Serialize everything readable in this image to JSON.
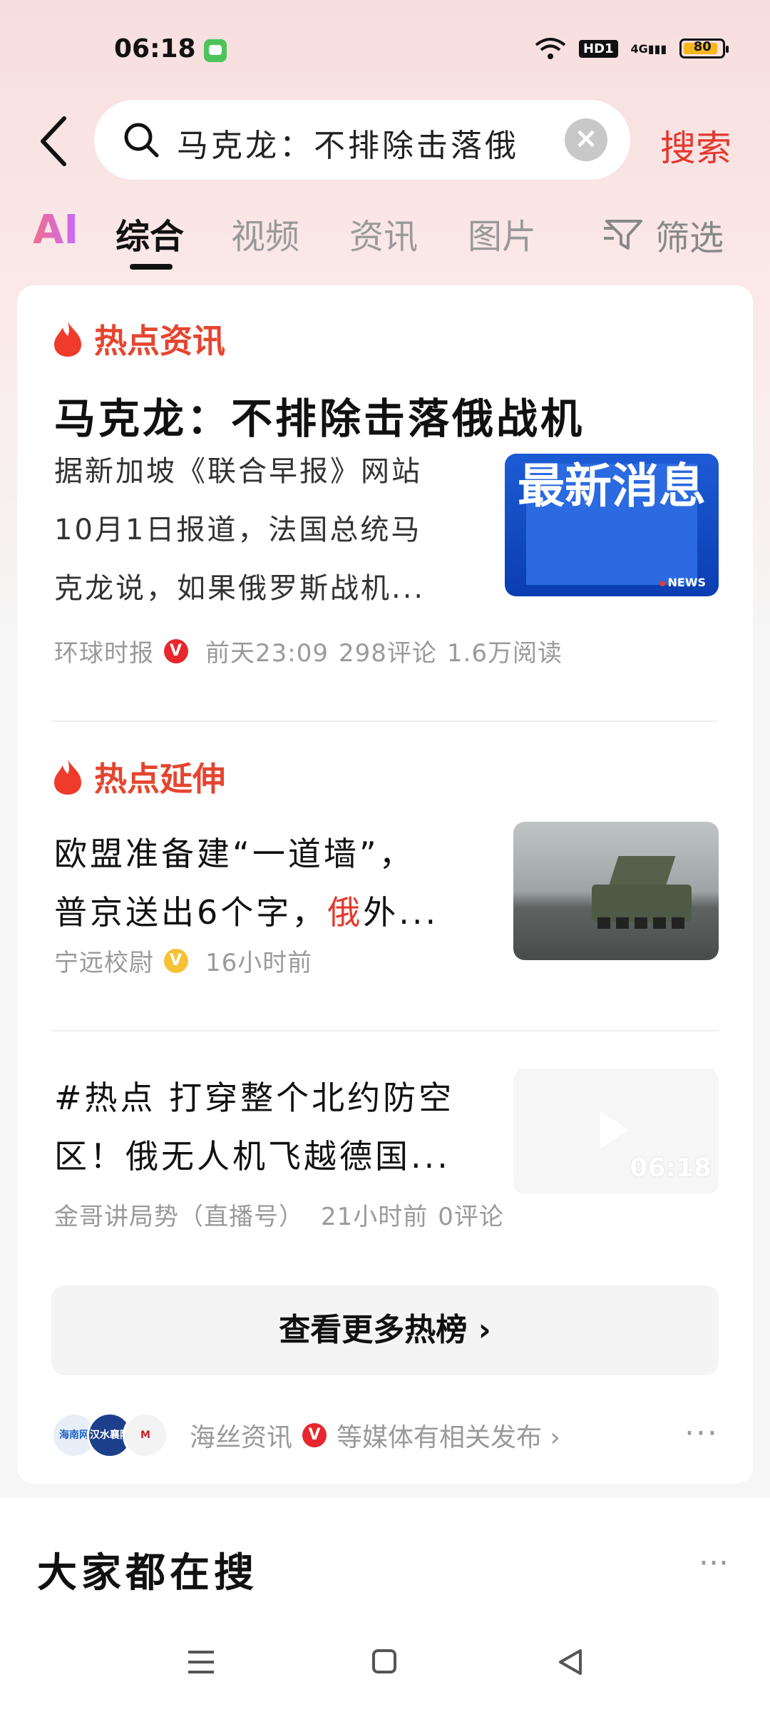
{
  "status": {
    "time": "06:18",
    "hd": "HD1",
    "network": "4G",
    "battery": "80",
    "battery_level_percent": 80
  },
  "search": {
    "query": "马克龙：不排除击落俄",
    "button": "搜索"
  },
  "tabs": {
    "ai": "AI",
    "items": [
      "综合",
      "视频",
      "资讯",
      "图片"
    ],
    "filter": "筛选"
  },
  "hot_news": {
    "section": "热点资讯",
    "headline": "马克龙：不排除击落俄战机",
    "lines": [
      "据新加坡《联合早报》网站",
      "10月1日报道，法国总统马",
      "克龙说，如果俄罗斯战机..."
    ],
    "thumb_title": "最新消息",
    "thumb_sub": "NEWS",
    "source": "环球时报",
    "badge": "V",
    "time": "前天23:09",
    "comments": "298评论",
    "reads": "1.6万阅读"
  },
  "hot_extend": {
    "section": "热点延伸",
    "line1": "欧盟准备建“一道墙”，",
    "line2a": "普京送出6个字，",
    "line2b": "俄",
    "line2c": "外...",
    "source": "宁远校尉",
    "badge": "V",
    "time": "16小时前"
  },
  "video_item": {
    "line1": "#热点 打穿整个北约防空",
    "line2": "区！俄无人机飞越德国...",
    "duration": "06:18",
    "source": "金哥讲局势（直播号）",
    "time": "21小时前",
    "comments": "0评论"
  },
  "more_button": "查看更多热榜 ›",
  "media": {
    "avatars": [
      "海南网",
      "汉水襄阳",
      "M"
    ],
    "name": "海丝资讯",
    "badge": "V",
    "suffix": "等媒体有相关发布 ›",
    "dots": "···"
  },
  "everyone": {
    "title": "大家都在搜",
    "dots": "···"
  }
}
